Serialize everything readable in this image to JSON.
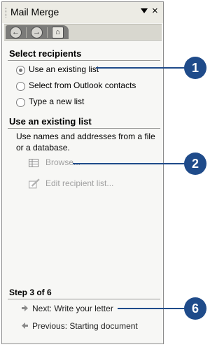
{
  "pane": {
    "title": "Mail Merge",
    "close_glyph": "×",
    "nav": {
      "back_icon": "back-arrow-icon",
      "forward_icon": "forward-arrow-icon",
      "home_icon": "home-icon"
    }
  },
  "select_recipients": {
    "heading": "Select recipients",
    "options": [
      {
        "label": "Use an existing list",
        "checked": true
      },
      {
        "label": "Select from Outlook contacts",
        "checked": false
      },
      {
        "label": "Type a new list",
        "checked": false
      }
    ]
  },
  "existing_list": {
    "heading": "Use an existing list",
    "description": "Use names and addresses from a file or a database.",
    "browse_label": "Browse...",
    "edit_label": "Edit recipient list..."
  },
  "step": {
    "label": "Step 3 of 6",
    "next_label": "Next: Write your letter",
    "prev_label": "Previous: Starting document"
  },
  "callouts": [
    "1",
    "2",
    "6"
  ],
  "colors": {
    "callout": "#1f4b8a",
    "disabled_text": "#a0a0a0"
  }
}
